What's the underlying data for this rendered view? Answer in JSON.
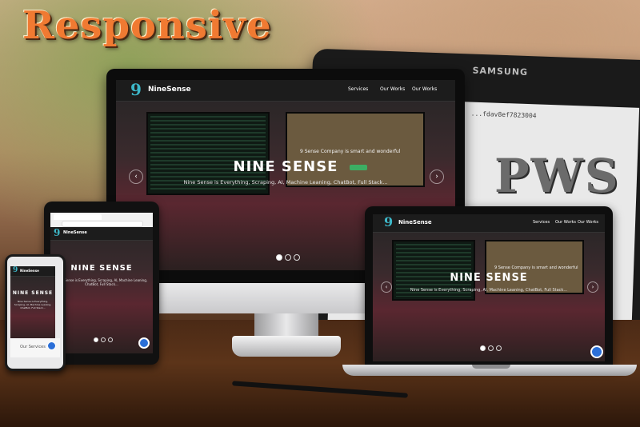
{
  "headline": "Responsive",
  "badge": "PWS",
  "background_device": {
    "brand": "SAMSUNG",
    "hash_text": "...fdav8ef7823004"
  },
  "site": {
    "brand": "NineSense",
    "logo_glyph": "9",
    "nav": [
      "Services",
      "Our Works",
      "Our Works"
    ],
    "hero_title": "NINE SENSE",
    "hero_subtitle": "Nine Sense is Everything, Scraping, AI, Machine Leaning, ChatBot, Full Stack...",
    "phone_subtitle": "Nine Sense is Everything, Scraping, AI, Machine Leaning, ChatBot, Full Stack...",
    "hero_tag": "9 Sense Company is smart and wonderful",
    "phone_footer": "Our Services",
    "prev_icon": "chevron-left-icon",
    "next_icon": "chevron-right-icon"
  },
  "colors": {
    "headline": "#f07a32",
    "badge": "#6b6b6b",
    "accent": "#3db8c9",
    "button": "#3cae63",
    "chat": "#2b6fd8"
  }
}
